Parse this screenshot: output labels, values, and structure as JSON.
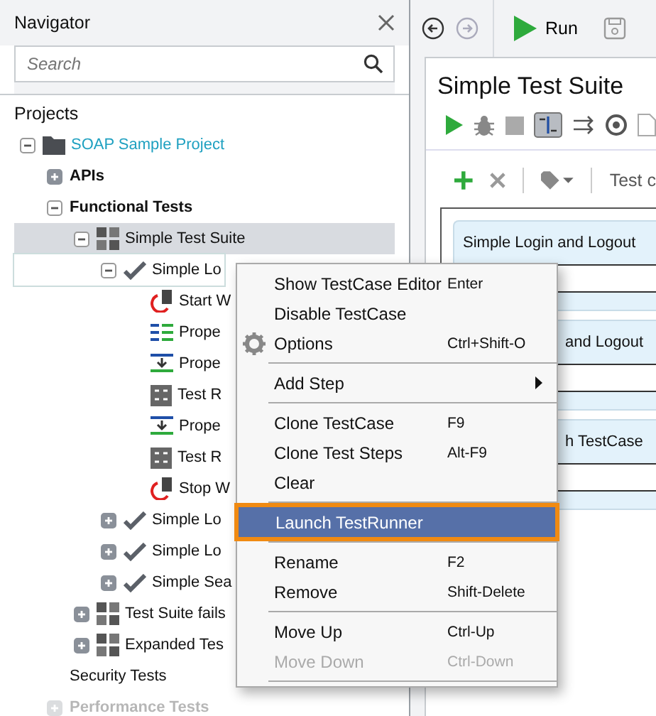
{
  "navigator": {
    "title": "Navigator",
    "search": {
      "placeholder": "Search"
    },
    "section": "Projects",
    "tree": [
      {
        "label": "SOAP Sample Project",
        "kind": "project",
        "expanded": true,
        "selected": false,
        "focused": false,
        "faded": false,
        "children": [
          {
            "label": "APIs",
            "kind": "group",
            "expanded": false,
            "selected": false,
            "focused": false,
            "faded": false
          },
          {
            "label": "Functional Tests",
            "kind": "group",
            "expanded": true,
            "selected": false,
            "focused": false,
            "faded": false,
            "children": [
              {
                "label": "Simple Test Suite",
                "kind": "suite",
                "expanded": true,
                "selected": true,
                "focused": false,
                "faded": false,
                "children": [
                  {
                    "label": "Simple Lo",
                    "kind": "case",
                    "expanded": true,
                    "selected": false,
                    "focused": true,
                    "faded": false,
                    "children": [
                      {
                        "label": "Start W",
                        "kind": "start",
                        "selected": false,
                        "focused": false,
                        "faded": false
                      },
                      {
                        "label": "Prope",
                        "kind": "props",
                        "selected": false,
                        "focused": false,
                        "faded": false
                      },
                      {
                        "label": "Prope",
                        "kind": "transfer",
                        "selected": false,
                        "focused": false,
                        "faded": false
                      },
                      {
                        "label": "Test R",
                        "kind": "soap",
                        "selected": false,
                        "focused": false,
                        "faded": false
                      },
                      {
                        "label": "Prope",
                        "kind": "transfer",
                        "selected": false,
                        "focused": false,
                        "faded": false
                      },
                      {
                        "label": "Test R",
                        "kind": "soap",
                        "selected": false,
                        "focused": false,
                        "faded": false
                      },
                      {
                        "label": "Stop W",
                        "kind": "start",
                        "selected": false,
                        "focused": false,
                        "faded": false
                      }
                    ]
                  },
                  {
                    "label": "Simple Lo",
                    "kind": "case",
                    "expanded": false,
                    "selected": false,
                    "focused": false,
                    "faded": false
                  },
                  {
                    "label": "Simple Lo",
                    "kind": "case",
                    "expanded": false,
                    "selected": false,
                    "focused": false,
                    "faded": false
                  },
                  {
                    "label": "Simple Sea",
                    "kind": "case",
                    "expanded": false,
                    "selected": false,
                    "focused": false,
                    "faded": false
                  }
                ]
              },
              {
                "label": "Test Suite fails",
                "kind": "suite",
                "expanded": false,
                "selected": false,
                "focused": false,
                "faded": false
              },
              {
                "label": "Expanded Tes",
                "kind": "suite",
                "expanded": false,
                "selected": false,
                "focused": false,
                "faded": false
              }
            ]
          },
          {
            "label": "Security Tests",
            "kind": "plain",
            "selected": false,
            "focused": false,
            "faded": false
          },
          {
            "label": "Performance Tests",
            "kind": "group",
            "expanded": false,
            "selected": false,
            "focused": false,
            "faded": true
          }
        ]
      }
    ]
  },
  "toolbar": {
    "run": "Run"
  },
  "editor": {
    "title": "Simple Test Suite",
    "filter_label": "Test c",
    "cards": [
      "Simple Login and Logout",
      "and Logout",
      "h TestCase"
    ]
  },
  "context_menu": [
    {
      "kind": "item",
      "label": "Show TestCase Editor",
      "shortcut": "Enter",
      "disabled": false,
      "selected": false
    },
    {
      "kind": "item",
      "label": "Disable TestCase",
      "disabled": false,
      "selected": false
    },
    {
      "kind": "gear_item",
      "label": "Options",
      "shortcut": "Ctrl+Shift-O",
      "disabled": false,
      "selected": false
    },
    {
      "kind": "separator"
    },
    {
      "kind": "submenu",
      "label": "Add Step",
      "disabled": false,
      "selected": false
    },
    {
      "kind": "separator"
    },
    {
      "kind": "item",
      "label": "Clone TestCase",
      "shortcut": "F9",
      "disabled": false,
      "selected": false
    },
    {
      "kind": "item",
      "label": "Clone Test Steps",
      "shortcut": "Alt-F9",
      "disabled": false,
      "selected": false
    },
    {
      "kind": "item",
      "label": "Clear",
      "disabled": false,
      "selected": false
    },
    {
      "kind": "separator"
    },
    {
      "kind": "item",
      "label": "Launch TestRunner",
      "disabled": false,
      "selected": true
    },
    {
      "kind": "separator"
    },
    {
      "kind": "item",
      "label": "Rename",
      "shortcut": "F2",
      "disabled": false,
      "selected": false
    },
    {
      "kind": "item",
      "label": "Remove",
      "shortcut": "Shift-Delete",
      "disabled": false,
      "selected": false
    },
    {
      "kind": "separator"
    },
    {
      "kind": "item",
      "label": "Move Up",
      "shortcut": "Ctrl-Up",
      "disabled": false,
      "selected": false
    },
    {
      "kind": "item",
      "label": "Move Down",
      "shortcut": "Ctrl-Down",
      "disabled": true,
      "selected": false
    },
    {
      "kind": "separator"
    }
  ]
}
